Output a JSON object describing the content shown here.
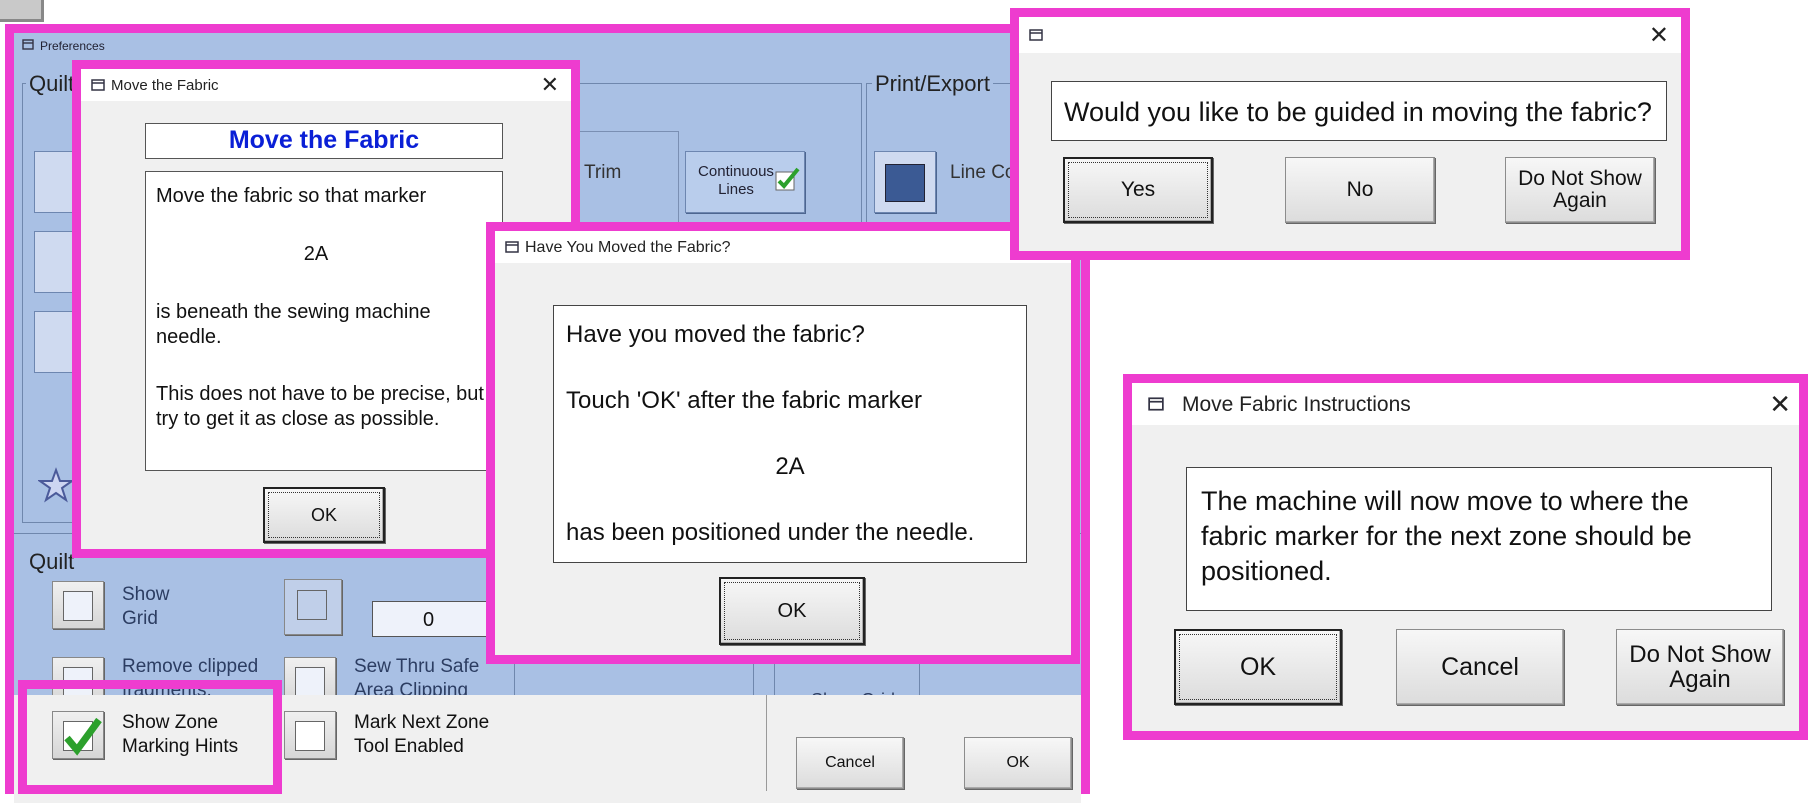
{
  "preferences": {
    "title": "Preferences",
    "group_quilt_top": "Quilt",
    "group_quilt_bottom": "Quilt",
    "group_print_export": "Print/Export",
    "trim_label": "Trim",
    "continuous_lines": "Continuous Lines",
    "line_color_label": "Line Co",
    "show_grid": "Show Grid",
    "grid_value": "0",
    "remove_clipped": "Remove clipped fragments.",
    "sew_thru_safe": "Sew Thru Safe Area Clipping",
    "show_grid_right": "Show Grid",
    "show_zone_hints": "Show Zone Marking Hints",
    "mark_next_zone": "Mark Next Zone Tool Enabled",
    "cancel": "Cancel",
    "ok": "OK"
  },
  "move_fabric_dialog": {
    "title": "Move the Fabric",
    "heading": "Move the Fabric",
    "line1": "Move the fabric so that marker",
    "marker": "2A",
    "line2": "is beneath the sewing machine needle.",
    "line3": "This does  not have to be precise, but try to get it as close as possible.",
    "ok": "OK"
  },
  "moved_dialog": {
    "title": "Have You Moved the Fabric?",
    "line1": "Have you moved the fabric?",
    "line2": "Touch 'OK' after the fabric marker",
    "marker": "2A",
    "line3": "has been positioned under the needle.",
    "ok": "OK"
  },
  "guided_dialog": {
    "question": "Would you like to be guided in moving the fabric?",
    "yes": "Yes",
    "no": "No",
    "do_not_show": "Do Not Show Again"
  },
  "instructions_dialog": {
    "title": "Move Fabric Instructions",
    "message": "The machine will now move to where the fabric marker for the next zone should be positioned.",
    "ok": "OK",
    "cancel": "Cancel",
    "do_not_show": "Do Not Show Again"
  },
  "colors": {
    "highlight": "#ee3ccf",
    "panel_blue": "#a9c0e4",
    "link_blue": "#0a1fd6",
    "check_green": "#2ca02c"
  }
}
